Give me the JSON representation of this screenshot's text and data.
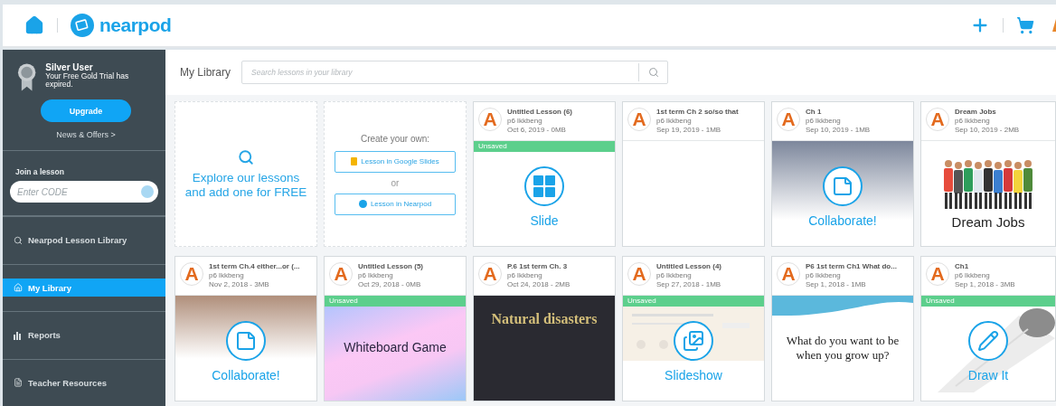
{
  "header": {
    "logo": "nearpod"
  },
  "sidebar": {
    "profile": {
      "plan": "Silver User",
      "message": "Your Free Gold Trial has expired.",
      "upgrade": "Upgrade",
      "news": "News & Offers >"
    },
    "join": {
      "label": "Join a lesson",
      "placeholder": "Enter CODE"
    },
    "nav": [
      {
        "label": "Nearpod Lesson Library",
        "selected": false
      },
      {
        "label": "My Library",
        "selected": true
      },
      {
        "label": "Reports",
        "selected": false
      },
      {
        "label": "Teacher Resources",
        "selected": false
      }
    ]
  },
  "library": {
    "title": "My Library",
    "search_placeholder": "Search lessons in your library"
  },
  "cards": [
    {
      "kind": "explore",
      "text": "Explore our lessons and add one for FREE"
    },
    {
      "kind": "create",
      "heading": "Create your own:",
      "separator": "or",
      "options": [
        "Lesson in Google Slides",
        "Lesson in Nearpod"
      ]
    },
    {
      "kind": "lesson",
      "avatar": "A",
      "title": "Untitled Lesson (6)",
      "author": "p6 lkkbeng",
      "meta": "Oct 6, 2019 - 0MB",
      "unsaved": true,
      "badge": "Unsaved",
      "thumb": {
        "kind": "slide",
        "label": "Slide"
      }
    },
    {
      "kind": "lesson",
      "avatar": "A",
      "title": "1st term Ch 2 so/so that",
      "author": "p6 lkkbeng",
      "meta": "Sep 19, 2019 - 1MB",
      "unsaved": false,
      "thumb": {
        "kind": "blank"
      }
    },
    {
      "kind": "lesson",
      "avatar": "A",
      "title": "Ch 1",
      "author": "p6 lkkbeng",
      "meta": "Sep 10, 2019 - 1MB",
      "unsaved": false,
      "thumb": {
        "kind": "collaborate_slate",
        "label": "Collaborate!"
      }
    },
    {
      "kind": "lesson",
      "avatar": "A",
      "title": "Dream Jobs",
      "author": "p6 lkkbeng",
      "meta": "Sep 10, 2019 - 2MB",
      "unsaved": false,
      "thumb": {
        "kind": "people",
        "text": "Dream Jobs"
      }
    },
    {
      "kind": "lesson",
      "avatar": "A",
      "title": "1st term Ch.4 either...or (...",
      "author": "p6 lkkbeng",
      "meta": "Nov 2, 2018 - 3MB",
      "unsaved": false,
      "thumb": {
        "kind": "collaborate_tan",
        "label": "Collaborate!"
      }
    },
    {
      "kind": "lesson",
      "avatar": "A",
      "title": "Untitled Lesson (5)",
      "author": "p6 lkkbeng",
      "meta": "Oct 29, 2018 - 0MB",
      "unsaved": true,
      "badge": "Unsaved",
      "thumb": {
        "kind": "pastel",
        "text": "Whiteboard Game"
      }
    },
    {
      "kind": "lesson",
      "avatar": "A",
      "title": "P.6 1st term Ch. 3",
      "author": "p6 lkkbeng",
      "meta": "Oct 24, 2018 - 2MB",
      "unsaved": false,
      "thumb": {
        "kind": "dark",
        "text": "Natural disasters"
      }
    },
    {
      "kind": "lesson",
      "avatar": "A",
      "title": "Untitled Lesson (4)",
      "author": "p6 lkkbeng",
      "meta": "Sep 27, 2018 - 1MB",
      "unsaved": true,
      "badge": "Unsaved",
      "thumb": {
        "kind": "slideshow",
        "label": "Slideshow"
      }
    },
    {
      "kind": "lesson",
      "avatar": "A",
      "title": "P6 1st term Ch1 What do...",
      "author": "p6 lkkbeng",
      "meta": "Sep 1, 2018 - 1MB",
      "unsaved": false,
      "thumb": {
        "kind": "wave",
        "text": "What do you want to be when you grow up?"
      }
    },
    {
      "kind": "lesson",
      "avatar": "A",
      "title": "Ch1",
      "author": "p6 lkkbeng",
      "meta": "Sep 1, 2018 - 3MB",
      "unsaved": true,
      "badge": "Unsaved",
      "thumb": {
        "kind": "draw",
        "label": "Draw It"
      }
    }
  ]
}
